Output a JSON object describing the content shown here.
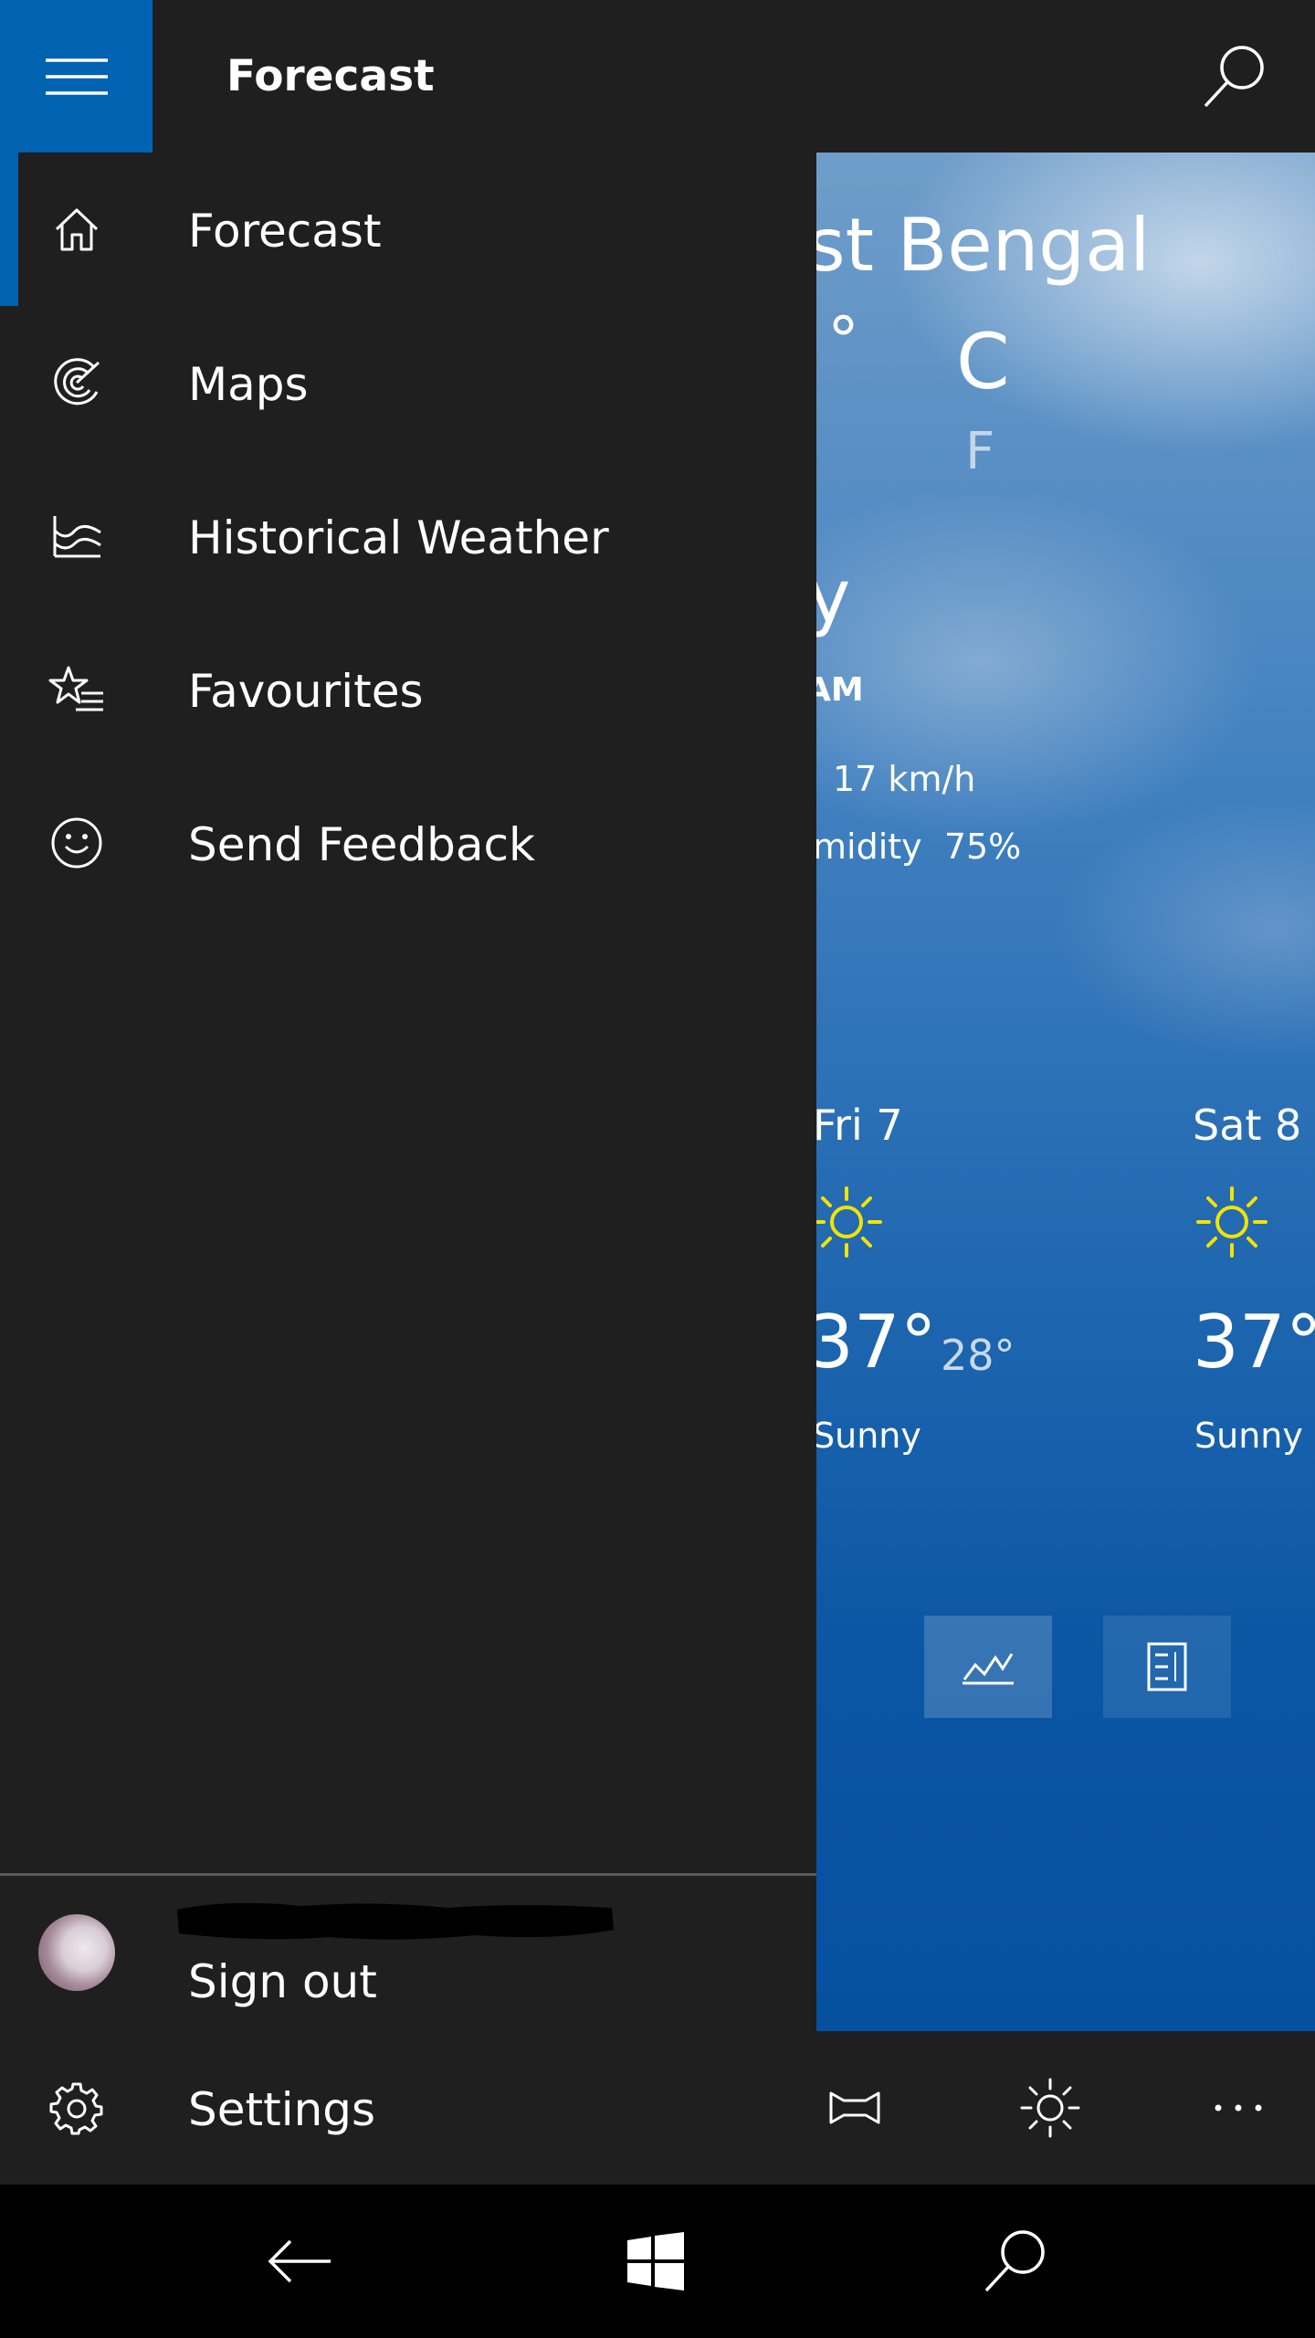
{
  "header": {
    "title": "Forecast",
    "menu_icon": "hamburger-icon",
    "search_icon": "search-icon"
  },
  "nav": {
    "items": [
      {
        "label": "Forecast",
        "icon": "home-icon",
        "active": true
      },
      {
        "label": "Maps",
        "icon": "radar-icon",
        "active": false
      },
      {
        "label": "Historical Weather",
        "icon": "chart-wave-icon",
        "active": false
      },
      {
        "label": "Favourites",
        "icon": "star-list-icon",
        "active": false
      },
      {
        "label": "Send Feedback",
        "icon": "smiley-icon",
        "active": false
      }
    ],
    "account": {
      "sign_out_label": "Sign out"
    },
    "settings_label": "Settings"
  },
  "weather": {
    "location": "st Bengal",
    "temperature_fragment": "°",
    "unit_celsius": "C",
    "unit_fahrenheit": "F",
    "condition_fragment": "y",
    "updated_fragment": "AM",
    "wind": "17 km/h",
    "humidity_label": "midity",
    "humidity_value": "75%",
    "days": [
      {
        "name": "Fri 7",
        "high": "37°",
        "low": "28°",
        "condition": "Sunny",
        "icon": "sun-icon"
      },
      {
        "name": "Sat 8",
        "high": "37°",
        "condition": "Sunny",
        "icon": "sun-icon"
      }
    ],
    "view_buttons": [
      "chart-view-icon",
      "list-view-icon"
    ]
  },
  "appbar": {
    "icons": [
      "pin-icon",
      "brightness-icon",
      "more-icon"
    ]
  },
  "system_nav": {
    "icons": [
      "back-icon",
      "windows-icon",
      "search-icon"
    ]
  },
  "colors": {
    "accent": "#0063b1",
    "pane": "#1f1f1f",
    "sun": "#f2e300"
  }
}
